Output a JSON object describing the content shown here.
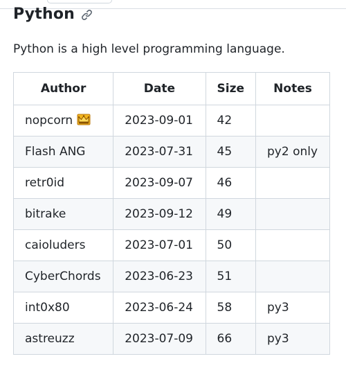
{
  "section": {
    "title": "Python",
    "description": "Python is a high level programming language."
  },
  "table": {
    "headers": {
      "author": "Author",
      "date": "Date",
      "size": "Size",
      "notes": "Notes"
    },
    "rows": [
      {
        "author": "nopcorn",
        "date": "2023-09-01",
        "size": "42",
        "notes": "",
        "emoji": "crown-icon"
      },
      {
        "author": "Flash ANG",
        "date": "2023-07-31",
        "size": "45",
        "notes": "py2 only"
      },
      {
        "author": "retr0id",
        "date": "2023-09-07",
        "size": "46",
        "notes": ""
      },
      {
        "author": "bitrake",
        "date": "2023-09-12",
        "size": "49",
        "notes": ""
      },
      {
        "author": "caioluders",
        "date": "2023-07-01",
        "size": "50",
        "notes": ""
      },
      {
        "author": "CyberChords",
        "date": "2023-06-23",
        "size": "51",
        "notes": ""
      },
      {
        "author": "int0x80",
        "date": "2023-06-24",
        "size": "58",
        "notes": "py3"
      },
      {
        "author": "astreuzz",
        "date": "2023-07-09",
        "size": "66",
        "notes": "py3"
      }
    ]
  },
  "colors": {
    "text": "#1f2328",
    "border": "#d0d7de",
    "stripe": "#f6f8fa",
    "link_icon": "#59636e",
    "crown": "#f2b51f"
  }
}
